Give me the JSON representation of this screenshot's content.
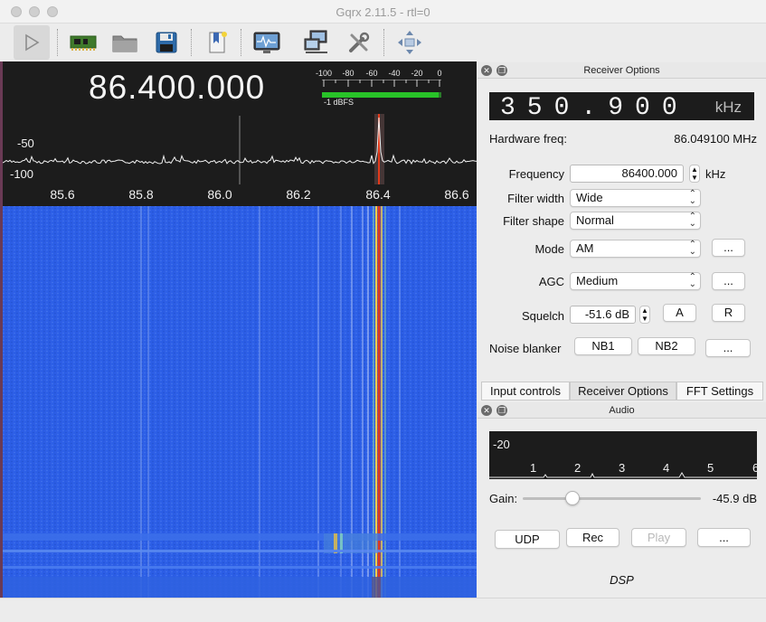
{
  "window": {
    "title": "Gqrx 2.11.5 - rtl=0"
  },
  "toolbar": {
    "items": [
      {
        "name": "start-dsp",
        "icon": "play-icon"
      },
      {
        "name": "device",
        "icon": "hardware-board-icon"
      },
      {
        "name": "open",
        "icon": "folder-icon"
      },
      {
        "name": "save",
        "icon": "floppy-disk-icon"
      },
      {
        "name": "bookmarks",
        "icon": "bookmark-book-icon"
      },
      {
        "name": "fft",
        "icon": "monitor-waveform-icon"
      },
      {
        "name": "remote",
        "icon": "network-computers-icon"
      },
      {
        "name": "settings",
        "icon": "tools-icon"
      },
      {
        "name": "fullscreen",
        "icon": "move-arrows-icon"
      }
    ]
  },
  "scope": {
    "frequency": "86.400.000",
    "smeter": {
      "ticks": [
        "-100",
        "-80",
        "-60",
        "-40",
        "-20",
        "0"
      ],
      "level_label": "-1 dBFS",
      "level_fraction": 0.98
    },
    "db_labels": [
      "-50",
      "-100"
    ],
    "freq_ticks": [
      "85.6",
      "85.8",
      "86.0",
      "86.2",
      "86.4",
      "86.6"
    ],
    "colors": {
      "waterfall": "#2c5ee6",
      "marker": "#e23a1a"
    }
  },
  "receiver_options": {
    "title": "Receiver Options",
    "offset_digits": "350.900",
    "offset_unit": "kHz",
    "hardware_freq_label": "Hardware freq:",
    "hardware_freq_value": "86.049100 MHz",
    "frequency_label": "Frequency",
    "frequency_value": "86400.000",
    "frequency_unit": "kHz",
    "filter_width_label": "Filter width",
    "filter_width_value": "Wide",
    "filter_shape_label": "Filter shape",
    "filter_shape_value": "Normal",
    "mode_label": "Mode",
    "mode_value": "AM",
    "mode_more": "...",
    "agc_label": "AGC",
    "agc_value": "Medium",
    "agc_more": "...",
    "squelch_label": "Squelch",
    "squelch_value": "-51.6 dB",
    "squelch_a": "A",
    "squelch_r": "R",
    "noise_blanker_label": "Noise blanker",
    "nb1": "NB1",
    "nb2": "NB2",
    "nb_more": "..."
  },
  "tabs": [
    {
      "label": "Input controls"
    },
    {
      "label": "Receiver Options"
    },
    {
      "label": "FFT Settings"
    }
  ],
  "audio": {
    "title": "Audio",
    "fft_label": "-20",
    "fft_ticks": [
      "1",
      "2",
      "3",
      "4",
      "5",
      "6"
    ],
    "gain_label": "Gain:",
    "gain_value": "-45.9 dB",
    "gain_fraction": 0.28,
    "udp": "UDP",
    "rec": "Rec",
    "play": "Play",
    "more": "...",
    "footer": "DSP"
  }
}
